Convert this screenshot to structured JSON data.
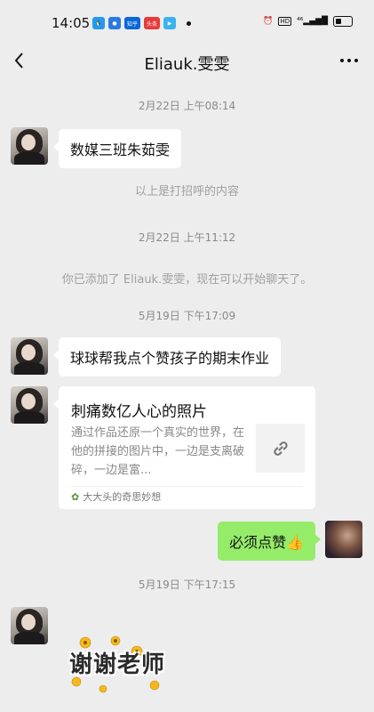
{
  "status_bar": {
    "time": "14:05",
    "app_icons": [
      {
        "name": "qq-icon",
        "color": "#1e9cf0",
        "text": "🐧"
      },
      {
        "name": "app-blue-icon",
        "color": "#2a7ae4",
        "text": "●"
      },
      {
        "name": "zhihu-icon",
        "color": "#0a66d9",
        "text": "知乎"
      },
      {
        "name": "toutiao-icon",
        "color": "#e63b3b",
        "text": "头条"
      },
      {
        "name": "play-icon",
        "color": "#3bb2f0",
        "text": "▶"
      }
    ],
    "right_text": "HD ⁴⁶"
  },
  "header": {
    "title": "Eliauk.雯雯"
  },
  "messages": {
    "ts1": "2月22日 上午08:14",
    "msg1": "数媒三班朱茹雯",
    "sys1": "以上是打招呼的内容",
    "ts2": "2月22日 上午11:12",
    "sys2": "你已添加了 Eliauk.雯雯，现在可以开始聊天了。",
    "ts3": "5月19日 下午17:09",
    "msg2": "球球帮我点个赞孩子的期末作业",
    "card": {
      "title": "刺痛数亿人心的照片",
      "desc": "通过作品还原一个真实的世界，在他的拼接的图片中，一边是支离破碎，一边是富...",
      "source": "大大头的奇思妙想"
    },
    "msg_me": "必须点赞👍",
    "ts4": "5月19日 下午17:15",
    "sticker_text": "谢谢老师"
  },
  "colors": {
    "bg": "#ededed",
    "green_bubble": "#95ec69",
    "sticker_flower": "#f5b81c"
  }
}
